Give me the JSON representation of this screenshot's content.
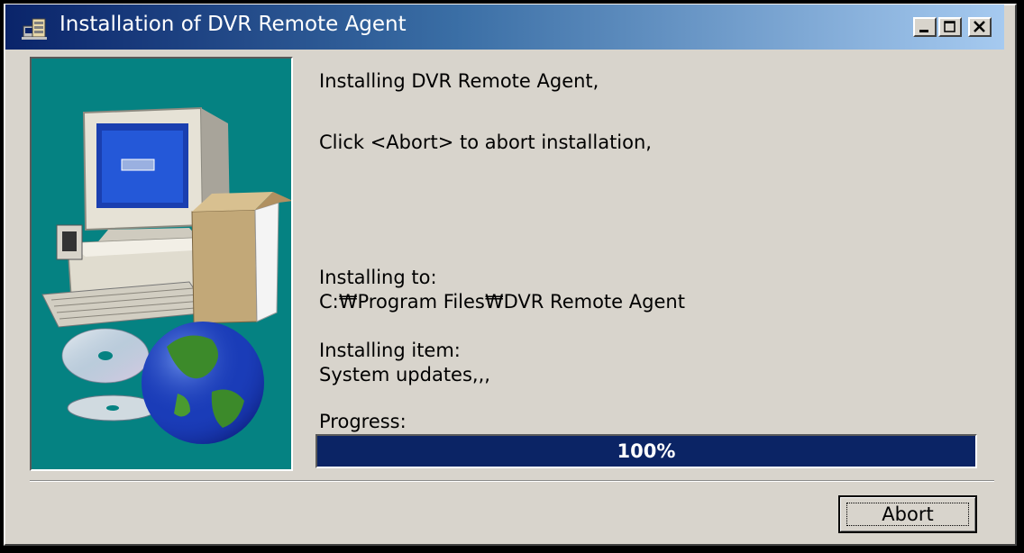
{
  "window": {
    "title": "Installation of DVR Remote Agent",
    "colors": {
      "titlebar_start": "#0a246a",
      "titlebar_end": "#a6caf0",
      "panel": "#058282",
      "progress": "#0b2465",
      "face": "#d8d4cc"
    }
  },
  "icons": {
    "title": "setup-icon",
    "minimize": "minimize-icon",
    "maximize": "maximize-icon",
    "close": "close-icon",
    "illustration": "computer-globe-cd-illustration"
  },
  "main": {
    "line1": "Installing DVR Remote Agent,",
    "line2": "Click <Abort> to abort installation,",
    "installing_to_label": "Installing to:",
    "installing_to_path": "C:₩Program Files₩DVR Remote Agent",
    "installing_item_label": "Installing item:",
    "installing_item_value": "System updates,,,",
    "progress_label": "Progress:",
    "progress_value": 1.0,
    "progress_text": "100%"
  },
  "buttons": {
    "abort": "Abort"
  }
}
